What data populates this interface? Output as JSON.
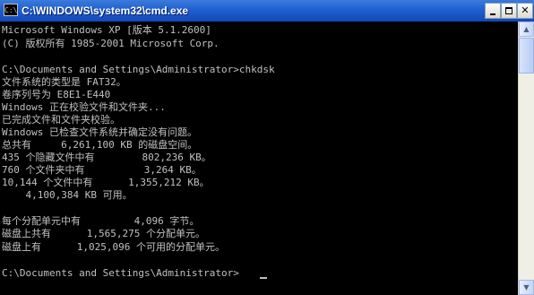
{
  "window": {
    "title": "C:\\WINDOWS\\system32\\cmd.exe",
    "icon": "cmd-icon",
    "buttons": {
      "minimize": "minimize-icon",
      "maximize": "maximize-icon",
      "close_label": "✕"
    }
  },
  "console": {
    "lines": [
      "Microsoft Windows XP [版本 5.1.2600]",
      "(C) 版权所有 1985-2001 Microsoft Corp.",
      "",
      "C:\\Documents and Settings\\Administrator>chkdsk",
      "文件系统的类型是 FAT32。",
      "卷序列号为 E8E1-E440",
      "Windows 正在校验文件和文件夹...",
      "已完成文件和文件夹校验。",
      "Windows 已检查文件系统并确定没有问题。",
      "总共有     6,261,100 KB 的磁盘空间。",
      "435 个隐藏文件中有        802,236 KB。",
      "760 个文件夹中有          3,264 KB。",
      "10,144 个文件中有      1,355,212 KB。",
      "    4,100,384 KB 可用。",
      "",
      "每个分配单元中有         4,096 字节。",
      "磁盘上共有      1,565,275 个分配单元。",
      "磁盘上有      1,025,096 个可用的分配单元。",
      "",
      "C:\\Documents and Settings\\Administrator>"
    ]
  },
  "scrollbar": {
    "up_arrow": "▲",
    "down_arrow": "▼"
  },
  "colors": {
    "console_bg": "#000000",
    "console_fg": "#c0c0c0",
    "titlebar": "#1f5fd0"
  }
}
